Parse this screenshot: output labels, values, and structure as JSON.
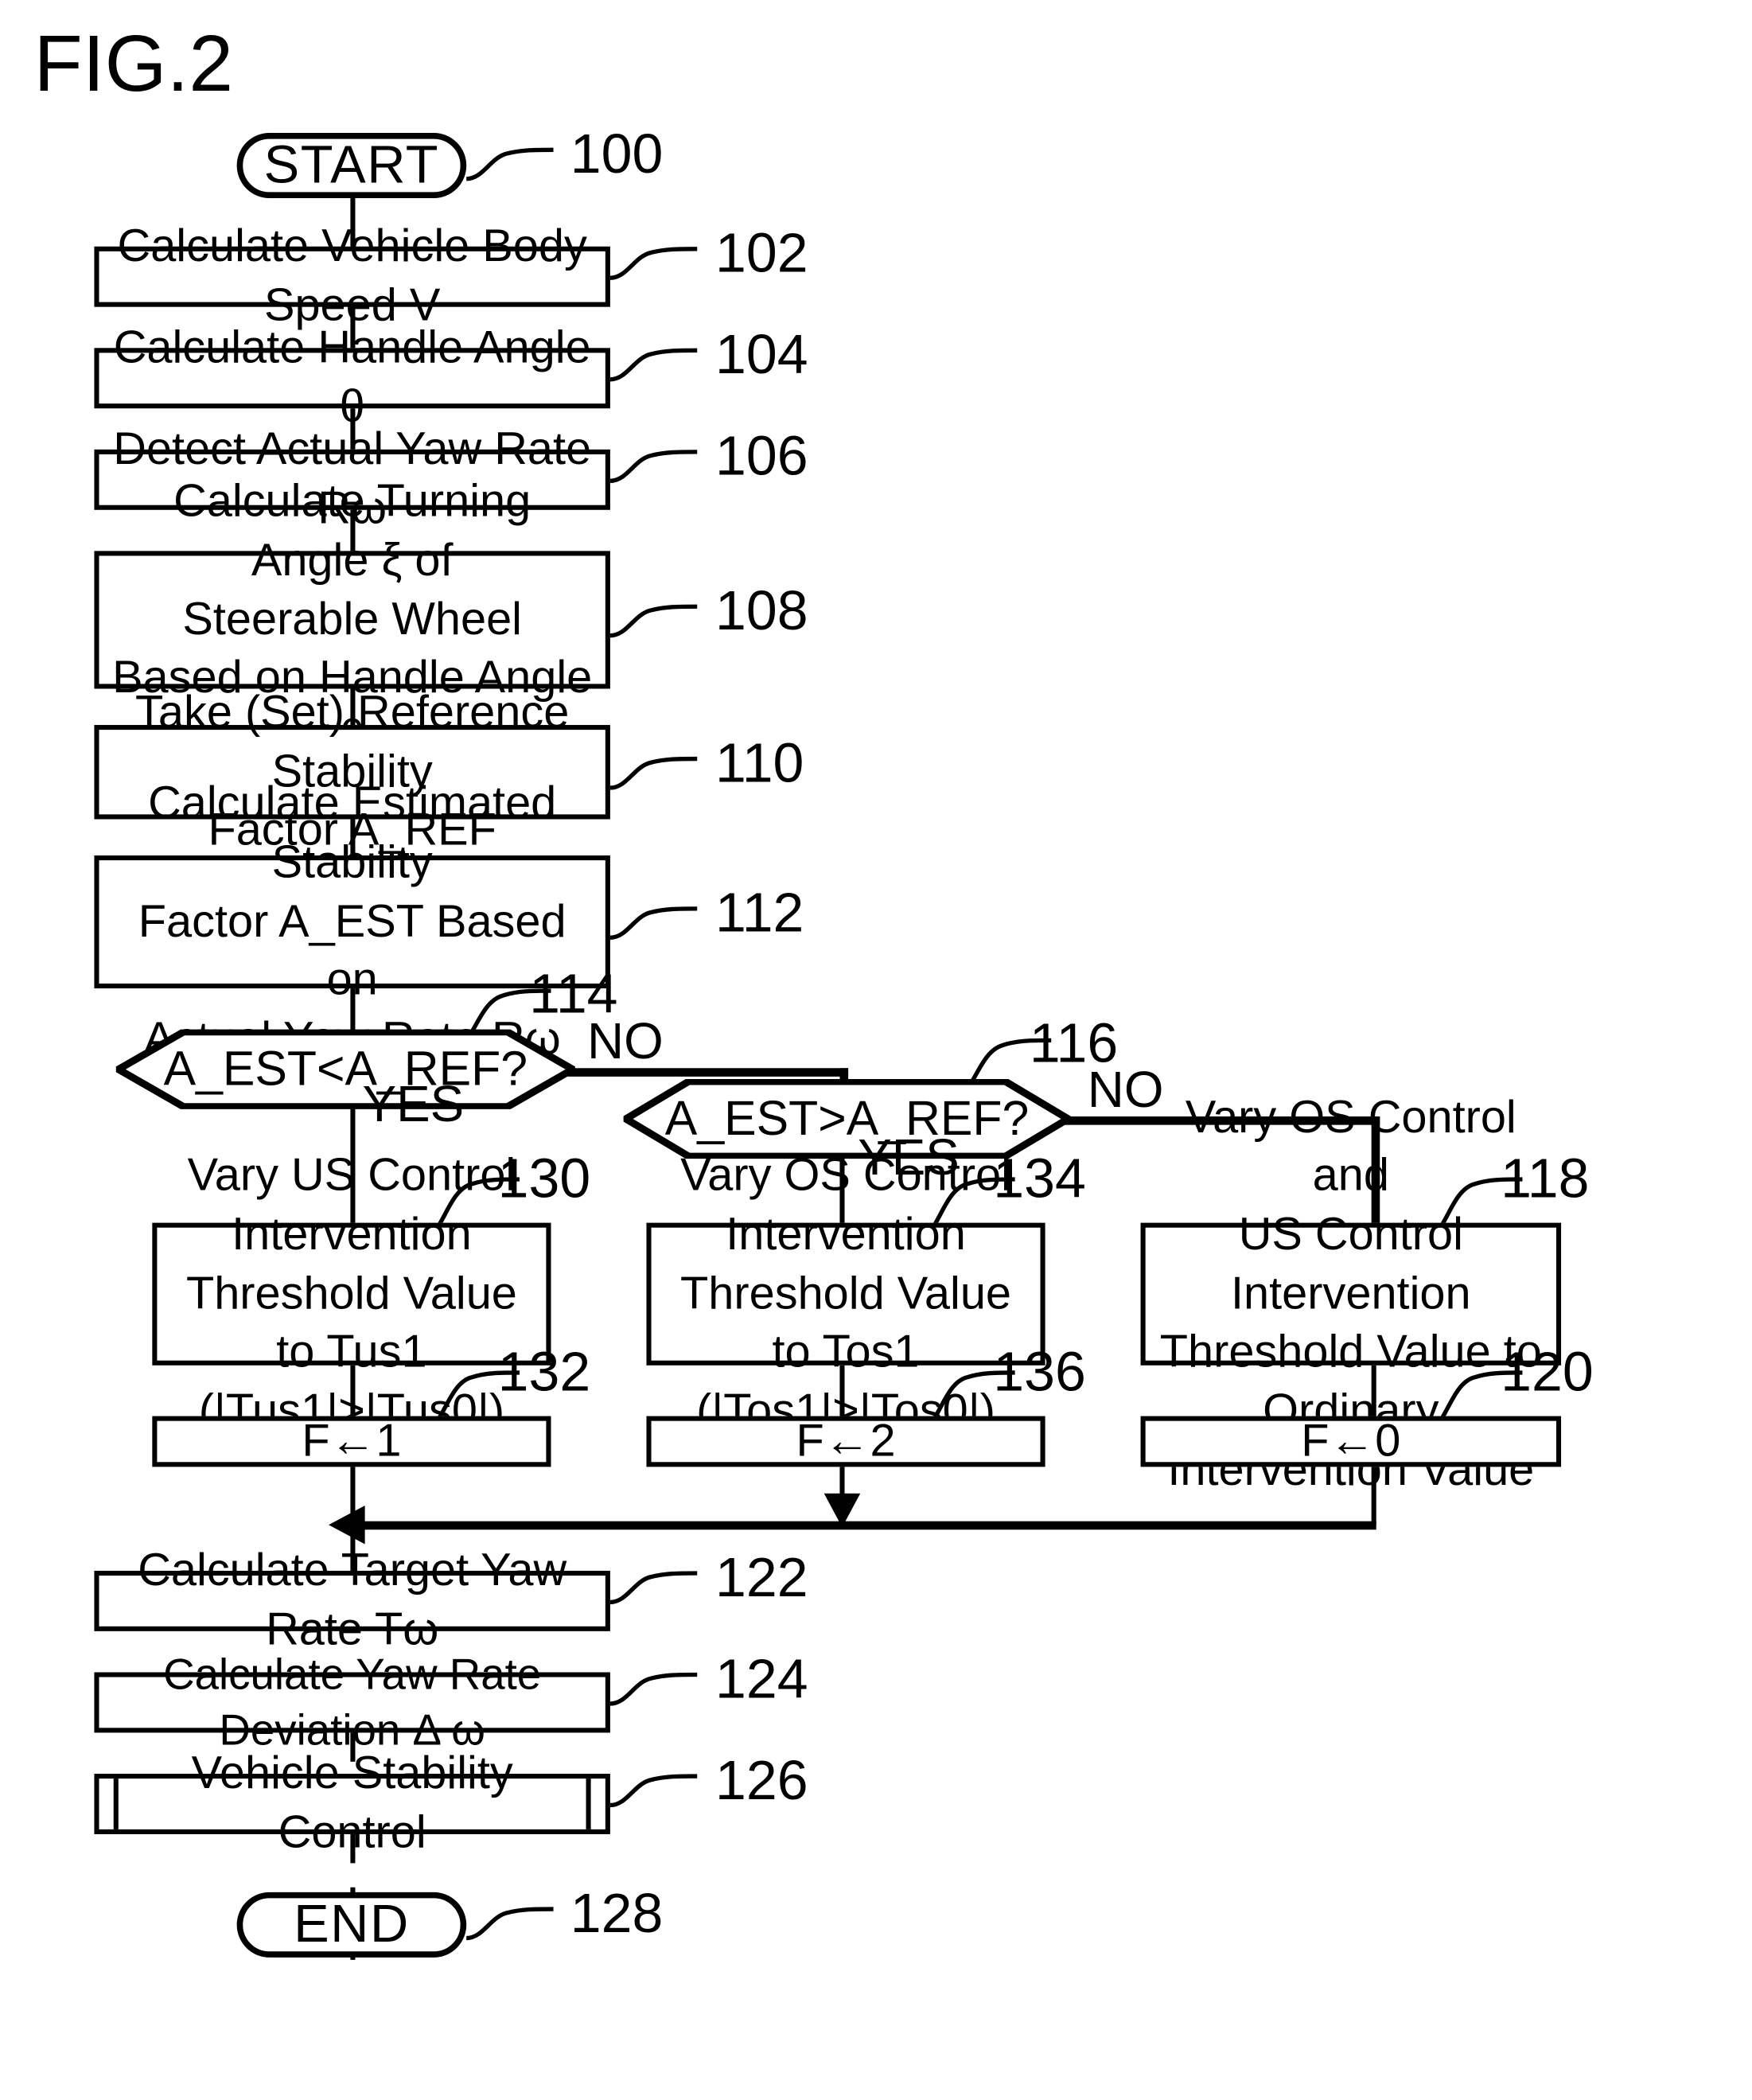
{
  "figure": {
    "title": "FIG.2"
  },
  "nodes": {
    "start": {
      "label": "START",
      "ref": "100"
    },
    "s102": {
      "label": "Calculate Vehicle Body Speed V",
      "ref": "102"
    },
    "s104": {
      "label": "Calculate Handle Angle  θ",
      "ref": "104"
    },
    "s106": {
      "label": "Detect Actual Yaw Rate Rω",
      "ref": "106"
    },
    "s108": {
      "label": "Calculate Turning Angle  ξ  of\nSteerable Wheel\nBased on Handle Angle  θ",
      "ref": "108"
    },
    "s110": {
      "label": "Take (Set) Reference Stability\nFactor A_REF",
      "ref": "110"
    },
    "s112": {
      "label": "Calculate Estimated Stability\nFactor A_EST Based on\nActual Yaw Rate Rω",
      "ref": "112"
    },
    "d114": {
      "label": "A_EST<A_REF?",
      "ref": "114",
      "yes": "YES",
      "no": "NO"
    },
    "d116": {
      "label": "A_EST>A_REF?",
      "ref": "116",
      "yes": "YES",
      "no": "NO"
    },
    "s130": {
      "label": "Vary US Control\nIntervention\nThreshold Value to Tus1\n(|Tus1|>|Tus0|)",
      "ref": "130"
    },
    "s134": {
      "label": "Vary OS Control\nIntervention\nThreshold Value to Tos1\n(|Tos1|>|Tos0|)",
      "ref": "134"
    },
    "s118": {
      "label": "Vary OS Control and\nUS Control Intervention\nThreshold Value to\nOrdinary Intervention Value",
      "ref": "118"
    },
    "s132": {
      "label": "F←1",
      "ref": "132"
    },
    "s136": {
      "label": "F←2",
      "ref": "136"
    },
    "s120": {
      "label": "F←0",
      "ref": "120"
    },
    "s122": {
      "label": "Calculate Target Yaw Rate Tω",
      "ref": "122"
    },
    "s124": {
      "label": "Calculate Yaw Rate Deviation Δ ω",
      "ref": "124"
    },
    "s126": {
      "label": "Vehicle Stability Control",
      "ref": "126"
    },
    "end": {
      "label": "END",
      "ref": "128"
    }
  },
  "colors": {
    "stroke": "#000000",
    "background": "#ffffff"
  }
}
